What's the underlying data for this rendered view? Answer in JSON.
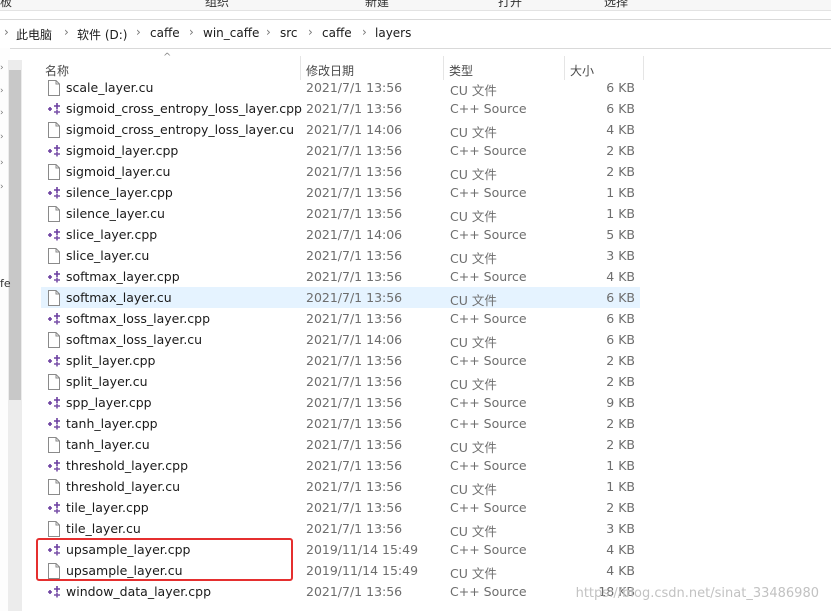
{
  "ribbon": {
    "labels": [
      "板",
      "组织",
      "新建",
      "打开",
      "选择"
    ]
  },
  "breadcrumb": [
    "此电脑",
    "软件 (D:)",
    "caffe",
    "win_caffe",
    "src",
    "caffe",
    "layers"
  ],
  "nav": {
    "partial_label": "fe"
  },
  "columns": {
    "name": "名称",
    "date": "修改日期",
    "type": "类型",
    "size": "大小"
  },
  "files": [
    {
      "name": "scale_layer.cu",
      "date": "2021/7/1 13:56",
      "type": "CU 文件",
      "size": "6 KB",
      "kind": "cu"
    },
    {
      "name": "sigmoid_cross_entropy_loss_layer.cpp",
      "date": "2021/7/1 13:56",
      "type": "C++ Source",
      "size": "6 KB",
      "kind": "cpp"
    },
    {
      "name": "sigmoid_cross_entropy_loss_layer.cu",
      "date": "2021/7/1 14:06",
      "type": "CU 文件",
      "size": "4 KB",
      "kind": "cu"
    },
    {
      "name": "sigmoid_layer.cpp",
      "date": "2021/7/1 13:56",
      "type": "C++ Source",
      "size": "2 KB",
      "kind": "cpp"
    },
    {
      "name": "sigmoid_layer.cu",
      "date": "2021/7/1 13:56",
      "type": "CU 文件",
      "size": "2 KB",
      "kind": "cu"
    },
    {
      "name": "silence_layer.cpp",
      "date": "2021/7/1 13:56",
      "type": "C++ Source",
      "size": "1 KB",
      "kind": "cpp"
    },
    {
      "name": "silence_layer.cu",
      "date": "2021/7/1 13:56",
      "type": "CU 文件",
      "size": "1 KB",
      "kind": "cu"
    },
    {
      "name": "slice_layer.cpp",
      "date": "2021/7/1 14:06",
      "type": "C++ Source",
      "size": "5 KB",
      "kind": "cpp"
    },
    {
      "name": "slice_layer.cu",
      "date": "2021/7/1 13:56",
      "type": "CU 文件",
      "size": "3 KB",
      "kind": "cu"
    },
    {
      "name": "softmax_layer.cpp",
      "date": "2021/7/1 13:56",
      "type": "C++ Source",
      "size": "4 KB",
      "kind": "cpp"
    },
    {
      "name": "softmax_layer.cu",
      "date": "2021/7/1 13:56",
      "type": "CU 文件",
      "size": "6 KB",
      "kind": "cu",
      "selected": true
    },
    {
      "name": "softmax_loss_layer.cpp",
      "date": "2021/7/1 13:56",
      "type": "C++ Source",
      "size": "6 KB",
      "kind": "cpp"
    },
    {
      "name": "softmax_loss_layer.cu",
      "date": "2021/7/1 14:06",
      "type": "CU 文件",
      "size": "6 KB",
      "kind": "cu"
    },
    {
      "name": "split_layer.cpp",
      "date": "2021/7/1 13:56",
      "type": "C++ Source",
      "size": "2 KB",
      "kind": "cpp"
    },
    {
      "name": "split_layer.cu",
      "date": "2021/7/1 13:56",
      "type": "CU 文件",
      "size": "2 KB",
      "kind": "cu"
    },
    {
      "name": "spp_layer.cpp",
      "date": "2021/7/1 13:56",
      "type": "C++ Source",
      "size": "9 KB",
      "kind": "cpp"
    },
    {
      "name": "tanh_layer.cpp",
      "date": "2021/7/1 13:56",
      "type": "C++ Source",
      "size": "2 KB",
      "kind": "cpp"
    },
    {
      "name": "tanh_layer.cu",
      "date": "2021/7/1 13:56",
      "type": "CU 文件",
      "size": "2 KB",
      "kind": "cu"
    },
    {
      "name": "threshold_layer.cpp",
      "date": "2021/7/1 13:56",
      "type": "C++ Source",
      "size": "1 KB",
      "kind": "cpp"
    },
    {
      "name": "threshold_layer.cu",
      "date": "2021/7/1 13:56",
      "type": "CU 文件",
      "size": "1 KB",
      "kind": "cu"
    },
    {
      "name": "tile_layer.cpp",
      "date": "2021/7/1 13:56",
      "type": "C++ Source",
      "size": "2 KB",
      "kind": "cpp"
    },
    {
      "name": "tile_layer.cu",
      "date": "2021/7/1 13:56",
      "type": "CU 文件",
      "size": "3 KB",
      "kind": "cu"
    },
    {
      "name": "upsample_layer.cpp",
      "date": "2019/11/14 15:49",
      "type": "C++ Source",
      "size": "4 KB",
      "kind": "cpp"
    },
    {
      "name": "upsample_layer.cu",
      "date": "2019/11/14 15:49",
      "type": "CU 文件",
      "size": "4 KB",
      "kind": "cu"
    },
    {
      "name": "window_data_layer.cpp",
      "date": "2021/7/1 13:56",
      "type": "C++ Source",
      "size": "18 KB",
      "kind": "cpp"
    }
  ],
  "watermark": "https://blog.csdn.net/sinat_33486980",
  "colors": {
    "selected_row": "#e5f3ff",
    "highlight_box": "#e52f2f",
    "cpp_icon": "#6b3fa0"
  }
}
